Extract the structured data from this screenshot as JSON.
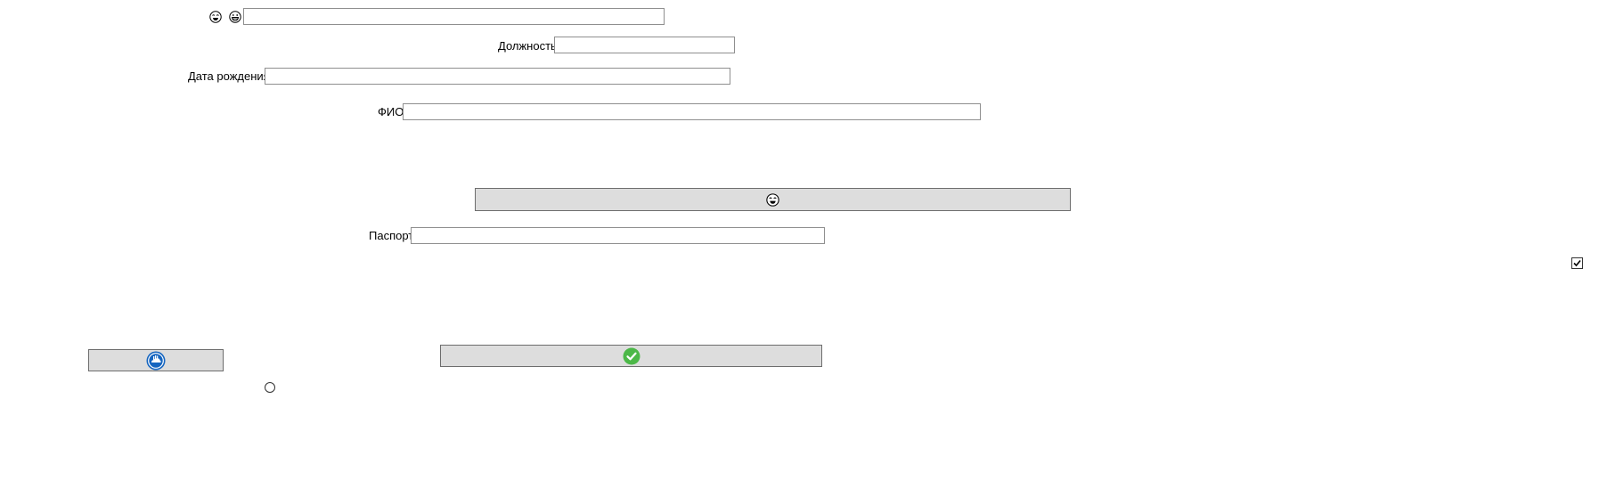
{
  "header_icons": {
    "icon1": "face-icon",
    "icon2": "grin-icon"
  },
  "fields": {
    "top": {
      "value": ""
    },
    "position": {
      "label": "Должность",
      "value": ""
    },
    "birthdate": {
      "label": "Дата рождения",
      "value": ""
    },
    "fio": {
      "label": "ФИО",
      "value": ""
    },
    "passport": {
      "label": "Паспорт",
      "value": ""
    }
  },
  "buttons": {
    "emoji_button": {
      "icon": "face-icon"
    },
    "confirm_button": {
      "icon": "check-circle-icon",
      "color": "#4cb848"
    },
    "blue_button": {
      "icon": "cloud-hand-icon",
      "color": "#1565c0"
    }
  },
  "checkbox": {
    "checked": true
  },
  "radio": {
    "checked": false
  }
}
